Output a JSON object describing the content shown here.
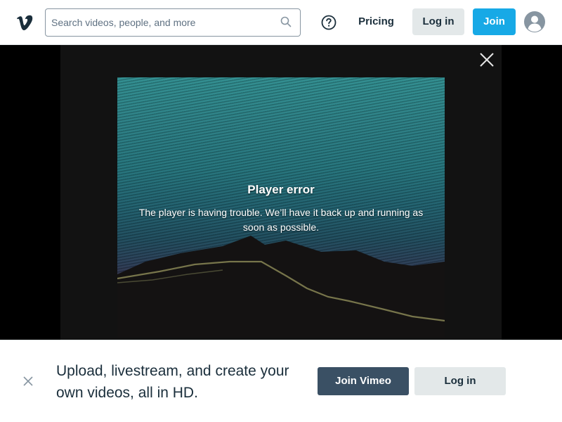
{
  "header": {
    "logo_icon": "vimeo-logo-icon",
    "search": {
      "placeholder": "Search videos, people, and more",
      "value": "",
      "icon": "search-icon"
    },
    "help_icon": "help-circle-icon",
    "pricing_label": "Pricing",
    "login_label": "Log in",
    "join_label": "Join",
    "avatar_icon": "user-avatar-icon"
  },
  "player": {
    "error_title": "Player error",
    "error_message": "The player is having trouble. We’ll have it back up and running as soon as possible.",
    "close_icon": "close-icon"
  },
  "banner": {
    "text": "Upload, livestream, and create your own videos, all in HD.",
    "join_label": "Join Vimeo",
    "login_label": "Log in",
    "close_icon": "close-icon"
  },
  "colors": {
    "brand_blue": "#17a9e6",
    "dark_button": "#3a5064",
    "text_dark": "#1a2e3b",
    "light_button": "#e3e8e9"
  }
}
